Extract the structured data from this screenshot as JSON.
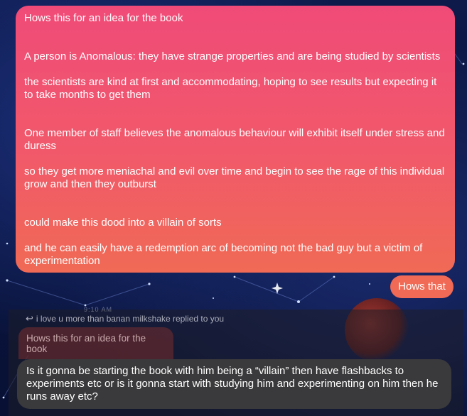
{
  "messages": {
    "main": {
      "paragraphs": [
        "Hows this for an idea for the book",
        "A person is Anomalous: they have strange properties and are being studied by scientists",
        "the scientists are kind at first and accommodating, hoping to see results but expecting it to take months to get them",
        "One member of staff believes the anomalous behaviour will exhibit itself under stress and duress",
        "so they get more meniachal and evil over time and begin to see the rage of this individual grow and then they outburst",
        "could make this dood into a villain of sorts",
        "and he can easily have a redemption arc of becoming not the bad guy but a victim of experimentation"
      ]
    },
    "short": "Hows that"
  },
  "reply": {
    "time_ghost": "9:10 AM",
    "header": "i love u more than banan milkshake replied to you",
    "quoted": "Hows this for an idea for the book",
    "text": "Is it gonna be starting the book with him being a “villain” then have flashbacks to experiments etc or is it gonna start with studying him and experimenting on him then he runs away etc?"
  },
  "colors": {
    "sent_bubble_top": "#f04b78",
    "sent_bubble_bottom": "#f06a55",
    "received_bubble": "#3a3a3c",
    "background": "#0d1a4a"
  },
  "icons": {
    "reply": "reply-arrow-icon"
  }
}
